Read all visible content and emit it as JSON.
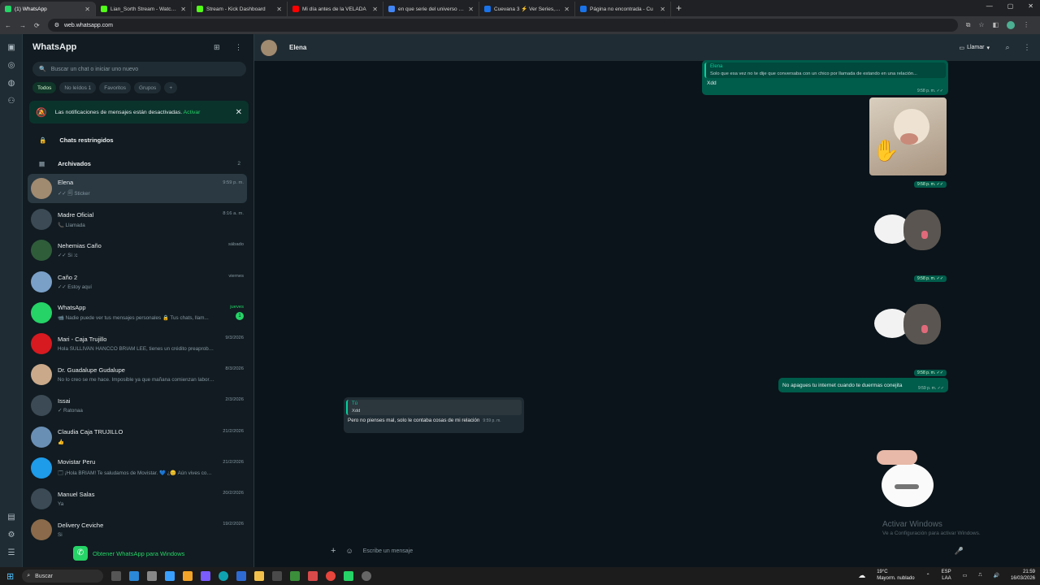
{
  "browser": {
    "tabs": [
      {
        "title": "(1) WhatsApp",
        "color": "#25d366",
        "active": true
      },
      {
        "title": "Lian_Sorth Stream - Watch Live",
        "color": "#53fc18"
      },
      {
        "title": "Stream - Kick Dashboard",
        "color": "#53fc18"
      },
      {
        "title": "Mi día antes de la VELADA",
        "color": "#ff0000"
      },
      {
        "title": "en que serie del universo de b",
        "color": "#4285f4"
      },
      {
        "title": "Cuevana 3 ⚡ Ver Series, Pelíc",
        "color": "#1a73e8"
      },
      {
        "title": "Página no encontrada - Cu",
        "color": "#1a73e8"
      }
    ],
    "url": "web.whatsapp.com"
  },
  "sidebar": {
    "title": "WhatsApp",
    "search_placeholder": "Buscar un chat o iniciar uno nuevo",
    "filters": [
      "Todos",
      "No leídos 1",
      "Favoritos",
      "Grupos"
    ],
    "notification": {
      "text": "Las notificaciones de mensajes están desactivadas.",
      "action": "Activar"
    },
    "restricted_label": "Chats restringidos",
    "archived_label": "Archivados",
    "archived_count": "2",
    "chats": [
      {
        "name": "Elena",
        "msg": "✓✓ 🗐 Sticker",
        "time": "9:59 p. m.",
        "avatar": "#a08a70",
        "selected": true
      },
      {
        "name": "Madre Oficial",
        "msg": "📞 Llamada",
        "time": "8:16 a. m.",
        "avatar": "#3b4a54"
      },
      {
        "name": "Nehemias Caño",
        "msg": "✓✓ Si :c",
        "time": "sábado",
        "avatar": "#2f5d3a"
      },
      {
        "name": "Caño 2",
        "msg": "✓✓ Estoy aquí",
        "time": "viernes",
        "avatar": "#7aa0c8"
      },
      {
        "name": "WhatsApp",
        "msg": "📹 Nadie puede ver tus mensajes personales 🔒 Tus chats, llam...",
        "time": "jueves",
        "avatar": "#25d366",
        "badge": "1"
      },
      {
        "name": "Mari - Caja Trujillo",
        "msg": "Hola SULLIVAN HANCCO BRIAM LEE, tienes un crédito preaprobado ...",
        "time": "9/3/2026",
        "avatar": "#d71920"
      },
      {
        "name": "Dr. Guadalupe Gudalupe",
        "msg": "No lo creo se me hace. Imposible ya que mañana comienzan labores...",
        "time": "8/3/2026",
        "avatar": "#c9a98a"
      },
      {
        "name": "Issai",
        "msg": "✓ Ratonaa",
        "time": "2/3/2026",
        "avatar": "#3b4a54"
      },
      {
        "name": "Claudia Caja TRUJILLO",
        "msg": "👍",
        "time": "21/2/2026",
        "avatar": "#6a8fb5"
      },
      {
        "name": "Movistar Peru",
        "msg": "🗔 ¡Hola BRIAM! Te saludamos de Movistar. 💙 ¿😊 Aún vives cont...",
        "time": "21/2/2026",
        "avatar": "#1e9be9"
      },
      {
        "name": "Manuel Salas",
        "msg": "Ya",
        "time": "20/2/2026",
        "avatar": "#3b4a54"
      },
      {
        "name": "Delivery Ceviche",
        "msg": "Si",
        "time": "19/2/2026",
        "avatar": "#8a6a4a"
      }
    ],
    "get_app": "Obtener WhatsApp para Windows"
  },
  "conversation": {
    "contact": "Elena",
    "call_label": "Llamar",
    "messages": {
      "m1_quote_name": "Elena",
      "m1_quote_text": "Solo que esa vez no te dije que conversaba con un chico por llamada de estando en una relación...",
      "m1_text": "Xdd",
      "m1_time": "9:58 p. m. ✓✓",
      "t_sticker1": "9:58 p. m. ✓✓",
      "t_sticker2": "9:58 p. m. ✓✓",
      "t_sticker3": "9:58 p. m. ✓✓",
      "m2_text": "No apagues tu internet cuando te duermas conejita",
      "m2_time": "9:59 p. m. ✓✓",
      "m3_quote_name": "Tú",
      "m3_quote_text": "Xdd",
      "m3_text": "Pero no pienses mal, solo le contaba cosas de mi relación",
      "m3_time": "9:59 p. m."
    },
    "composer_placeholder": "Escribe un mensaje",
    "watermark_title": "Activar Windows",
    "watermark_sub": "Ve a Configuración para activar Windows."
  },
  "taskbar": {
    "search": "Buscar",
    "weather_temp": "19°C",
    "weather_text": "Mayorm. nublado",
    "lang1": "ESP",
    "lang2": "LAA",
    "time": "21:59",
    "date": "16/03/2026"
  }
}
